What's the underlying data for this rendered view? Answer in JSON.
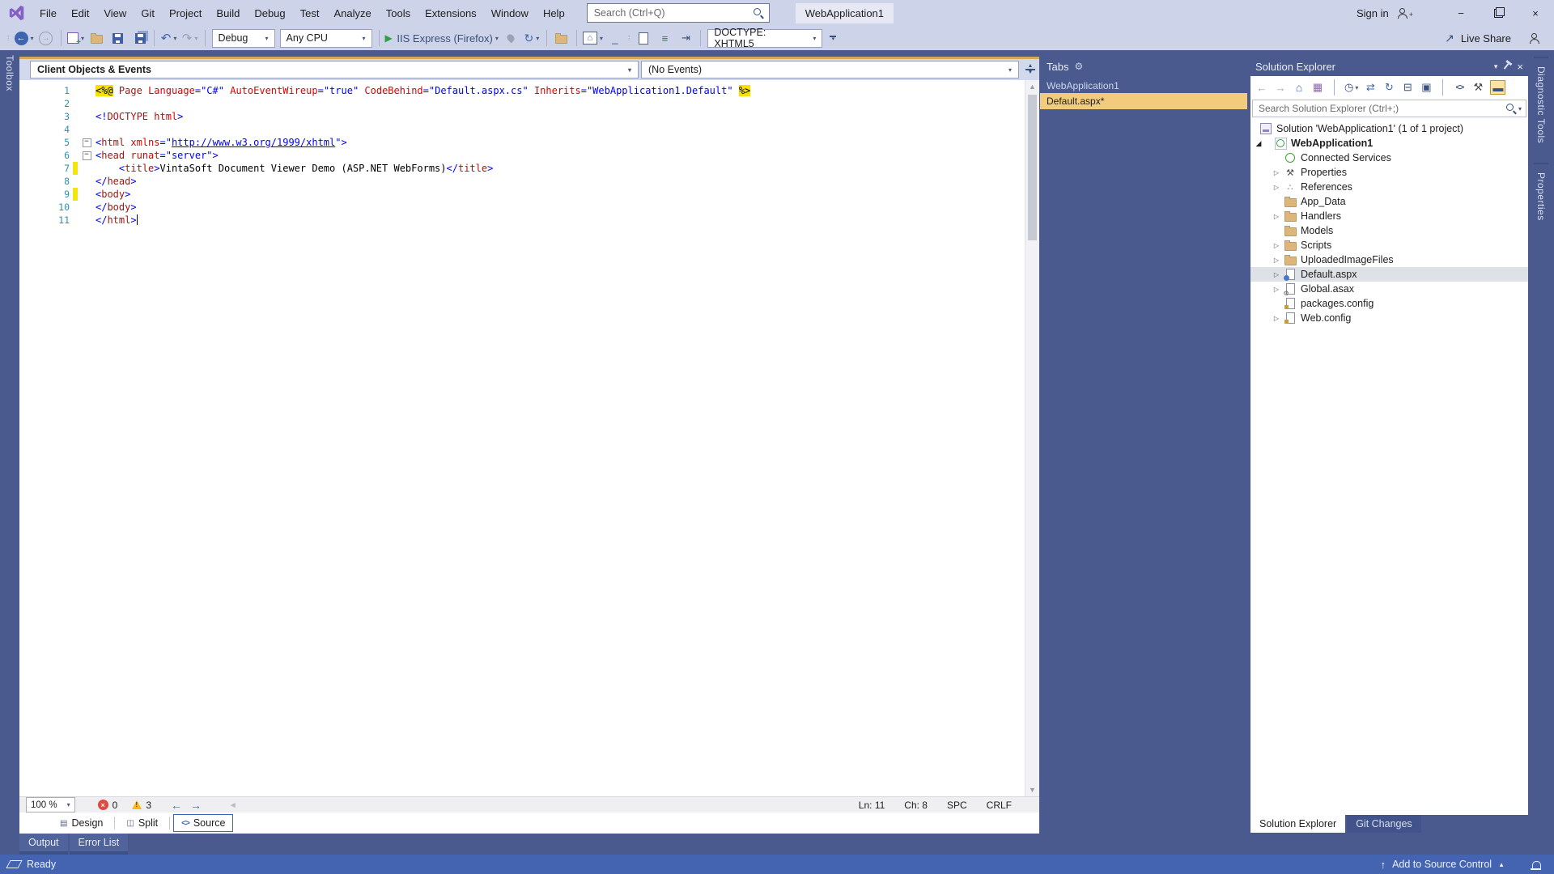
{
  "titlebar": {
    "menus": [
      "File",
      "Edit",
      "View",
      "Git",
      "Project",
      "Build",
      "Debug",
      "Test",
      "Analyze",
      "Tools",
      "Extensions",
      "Window",
      "Help"
    ],
    "search_placeholder": "Search (Ctrl+Q)",
    "window_title": "WebApplication1",
    "sign_in": "Sign in"
  },
  "toolbar": {
    "debug_config": "Debug",
    "platform": "Any CPU",
    "run_target": "IIS Express (Firefox)",
    "doctype": "DOCTYPE: XHTML5",
    "live_share": "Live Share"
  },
  "editor": {
    "nav_left": "Client Objects & Events",
    "nav_right": "(No Events)",
    "zoom": "100 %",
    "error_count": "0",
    "warning_count": "3",
    "position": {
      "line": "Ln: 11",
      "column": "Ch: 8",
      "spaces": "SPC",
      "eol": "CRLF"
    },
    "view_tabs": [
      "Design",
      "Split",
      "Source"
    ],
    "active_view_tab": "Source",
    "lines": [
      {
        "n": 1,
        "seg": [
          [
            "Y",
            "<%@"
          ],
          [
            "K",
            " "
          ],
          [
            "M",
            "Page"
          ],
          [
            "K",
            " "
          ],
          [
            "R",
            "Language"
          ],
          [
            "B",
            "=\"C#\""
          ],
          [
            "K",
            " "
          ],
          [
            "R",
            "AutoEventWireup"
          ],
          [
            "B",
            "=\"true\""
          ],
          [
            "K",
            " "
          ],
          [
            "R",
            "CodeBehind"
          ],
          [
            "B",
            "=\"Default.aspx.cs\""
          ],
          [
            "K",
            " "
          ],
          [
            "R",
            "Inherits"
          ],
          [
            "B",
            "=\"WebApplication1.Default\""
          ],
          [
            "K",
            " "
          ],
          [
            "Y",
            "%>"
          ]
        ]
      },
      {
        "n": 2,
        "seg": []
      },
      {
        "n": 3,
        "seg": [
          [
            "B",
            "<!"
          ],
          [
            "M",
            "DOCTYPE"
          ],
          [
            "K",
            " "
          ],
          [
            "R",
            "html"
          ],
          [
            "B",
            ">"
          ]
        ]
      },
      {
        "n": 4,
        "seg": []
      },
      {
        "n": 5,
        "fold": true,
        "seg": [
          [
            "B",
            "<"
          ],
          [
            "M",
            "html"
          ],
          [
            "K",
            " "
          ],
          [
            "R",
            "xmlns"
          ],
          [
            "B",
            "=\""
          ],
          [
            "U",
            "http://www.w3.org/1999/xhtml"
          ],
          [
            "B",
            "\">"
          ]
        ]
      },
      {
        "n": 6,
        "fold": true,
        "seg": [
          [
            "B",
            "<"
          ],
          [
            "M",
            "head"
          ],
          [
            "K",
            " "
          ],
          [
            "R",
            "runat"
          ],
          [
            "B",
            "=\"server\">"
          ]
        ]
      },
      {
        "n": 7,
        "changed": true,
        "seg": [
          [
            "K",
            "    "
          ],
          [
            "B",
            "<"
          ],
          [
            "M",
            "title"
          ],
          [
            "B",
            ">"
          ],
          [
            "K",
            "VintaSoft Document Viewer Demo (ASP.NET WebForms)"
          ],
          [
            "B",
            "</"
          ],
          [
            "M",
            "title"
          ],
          [
            "B",
            ">"
          ]
        ]
      },
      {
        "n": 8,
        "seg": [
          [
            "B",
            "</"
          ],
          [
            "M",
            "head"
          ],
          [
            "B",
            ">"
          ]
        ]
      },
      {
        "n": 9,
        "changed": true,
        "seg": [
          [
            "B",
            "<"
          ],
          [
            "M",
            "body"
          ],
          [
            "B",
            ">"
          ]
        ]
      },
      {
        "n": 10,
        "seg": [
          [
            "B",
            "</"
          ],
          [
            "M",
            "body"
          ],
          [
            "B",
            ">"
          ]
        ]
      },
      {
        "n": 11,
        "caret": true,
        "seg": [
          [
            "B",
            "</"
          ],
          [
            "M",
            "html"
          ],
          [
            "B",
            ">"
          ]
        ]
      }
    ]
  },
  "tabs_panel": {
    "title": "Tabs",
    "group_label": "WebApplication1",
    "documents": [
      "Default.aspx*"
    ]
  },
  "solution_explorer": {
    "title": "Solution Explorer",
    "search_placeholder": "Search Solution Explorer (Ctrl+;)",
    "tree": [
      {
        "label": "Solution 'WebApplication1' (1 of 1 project)",
        "icon": "solution",
        "level": 0,
        "exp": null
      },
      {
        "label": "WebApplication1",
        "icon": "project",
        "level": 0,
        "exp": "open",
        "bold": true
      },
      {
        "label": "Connected Services",
        "icon": "services",
        "level": 1,
        "exp": null
      },
      {
        "label": "Properties",
        "icon": "wrench",
        "level": 1,
        "exp": "closed"
      },
      {
        "label": "References",
        "icon": "refs",
        "level": 1,
        "exp": "closed"
      },
      {
        "label": "App_Data",
        "icon": "folder",
        "level": 1,
        "exp": null
      },
      {
        "label": "Handlers",
        "icon": "folder",
        "level": 1,
        "exp": "closed"
      },
      {
        "label": "Models",
        "icon": "folder",
        "level": 1,
        "exp": null
      },
      {
        "label": "Scripts",
        "icon": "folder",
        "level": 1,
        "exp": "closed"
      },
      {
        "label": "UploadedImageFiles",
        "icon": "folder",
        "level": 1,
        "exp": "closed"
      },
      {
        "label": "Default.aspx",
        "icon": "aspx",
        "level": 1,
        "exp": "closed",
        "selected": true
      },
      {
        "label": "Global.asax",
        "icon": "asax",
        "level": 1,
        "exp": "closed"
      },
      {
        "label": "packages.config",
        "icon": "config",
        "level": 1,
        "exp": null
      },
      {
        "label": "Web.config",
        "icon": "config",
        "level": 1,
        "exp": "closed"
      }
    ],
    "bottom_tabs": [
      "Solution Explorer",
      "Git Changes"
    ],
    "active_bottom_tab": "Solution Explorer"
  },
  "side_panels": {
    "left_tab": "Toolbox",
    "right_tabs": [
      "Diagnostic Tools",
      "Properties"
    ],
    "bottom_left_tabs": [
      "Output",
      "Error List"
    ]
  },
  "statusbar": {
    "ready": "Ready",
    "add_to_source_control": "Add to Source Control"
  },
  "icons": {
    "dropdown_arrow": "▾",
    "back_arrow": "←",
    "forward_arrow": "→",
    "undo": "↶",
    "redo": "↷",
    "refresh": "↻",
    "run_play": "▶",
    "home": "⌂",
    "gear": "⚙",
    "wrench": "⚒",
    "sync": "⇄",
    "collapse_all": "⊟",
    "show_all_files": "▣",
    "switch_views": "▦",
    "pending_changes_clock": "◷",
    "view_code": "<>",
    "references": "∴",
    "scroll_up": "▲",
    "scroll_down": "▼",
    "expander_collapsed": "▷",
    "expander_expanded": "◢",
    "minimize": "−",
    "close": "×",
    "error_x": "×",
    "up_arrow": "↑",
    "live_share": "↗",
    "list": "≡",
    "indent": "⇥",
    "underscore": "_"
  },
  "colors": {
    "titlebar_bg": "#CDD3E8",
    "workspace_bg": "#4A5A8E",
    "statusbar_bg": "#4463B0",
    "active_doc_tab": "#F2CB7E",
    "tree_selection": "#DEE1E6",
    "folder_tan": "#DCB67A",
    "asp_highlight_yellow": "#F8E000",
    "error_red": "#E04A3F",
    "warning_yellow": "#FDB813",
    "code_tag_maroon": "#A31515",
    "code_attr_red": "#E00000",
    "code_value_blue": "#0000FF",
    "line_number_teal": "#2B91AF"
  }
}
